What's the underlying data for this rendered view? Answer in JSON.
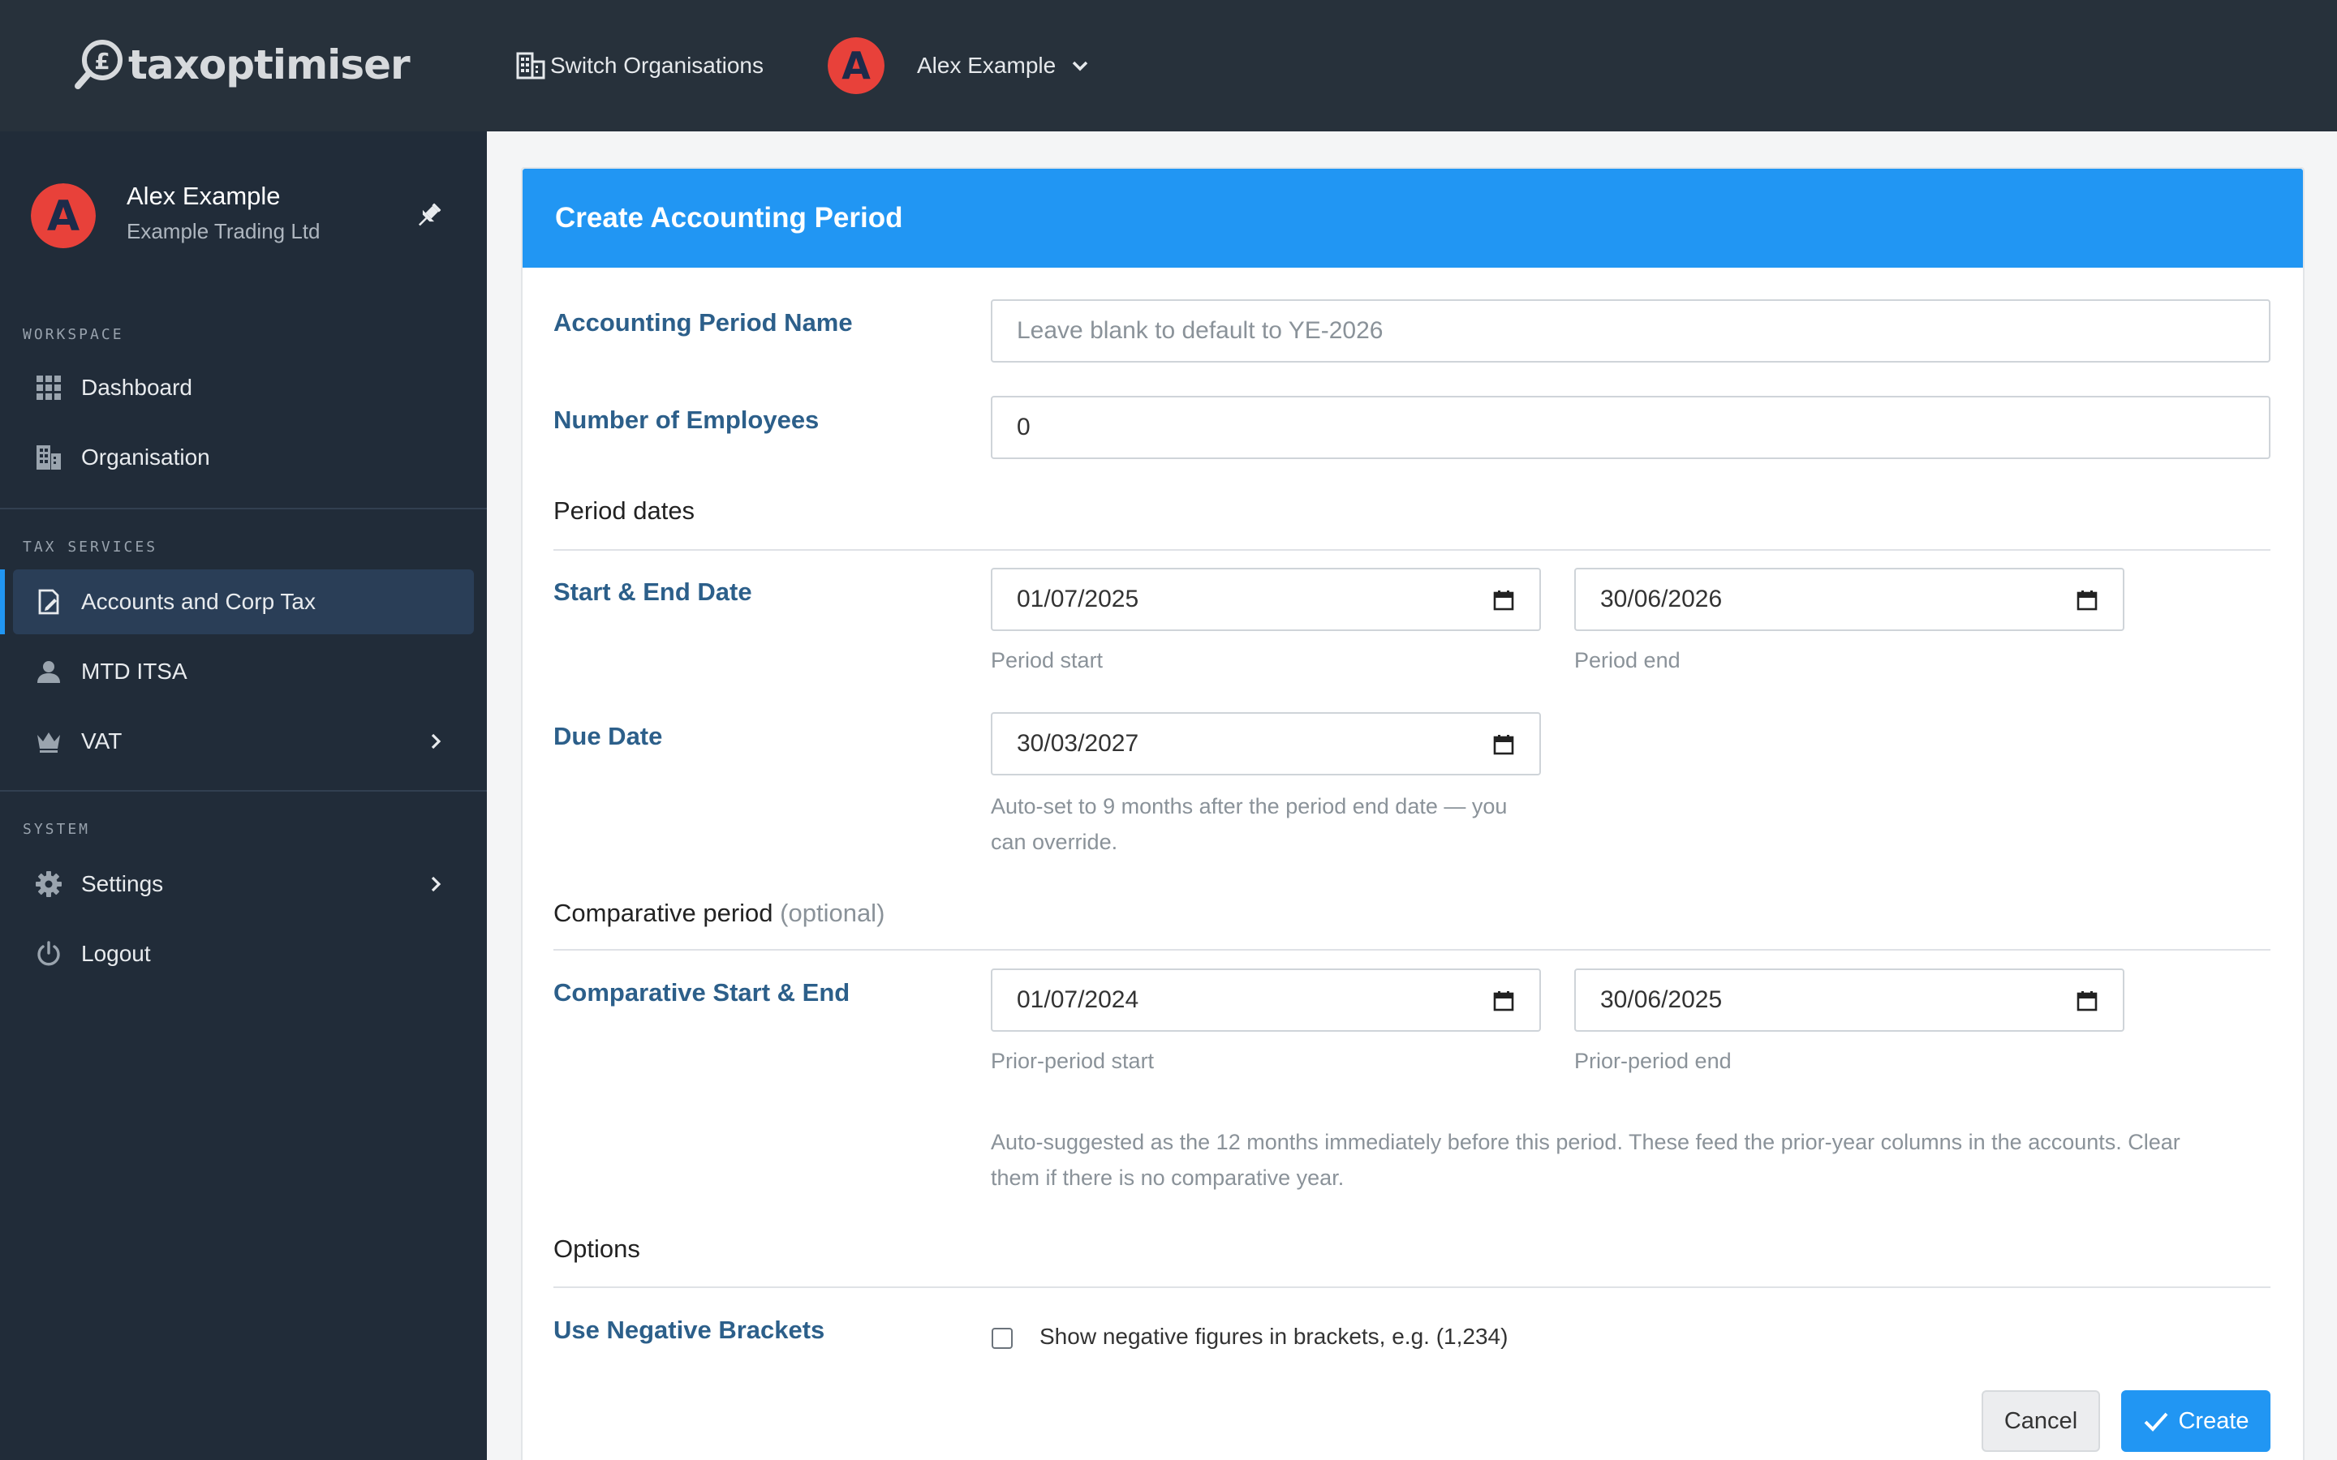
{
  "brand": {
    "name": "taxoptimiser"
  },
  "topbar": {
    "switch_org_label": "Switch Organisations",
    "user_name": "Alex Example",
    "avatar_letter": "A"
  },
  "sidebar": {
    "profile": {
      "name": "Alex Example",
      "org": "Example Trading Ltd",
      "avatar_letter": "A"
    },
    "sections": [
      {
        "label": "WORKSPACE",
        "items": [
          {
            "label": "Dashboard",
            "icon": "grid-icon"
          },
          {
            "label": "Organisation",
            "icon": "building-icon"
          }
        ]
      },
      {
        "label": "TAX SERVICES",
        "items": [
          {
            "label": "Accounts and Corp Tax",
            "icon": "document-edit-icon",
            "active": true
          },
          {
            "label": "MTD ITSA",
            "icon": "person-icon"
          },
          {
            "label": "VAT",
            "icon": "crown-icon",
            "has_submenu": true
          }
        ]
      },
      {
        "label": "SYSTEM",
        "items": [
          {
            "label": "Settings",
            "icon": "gear-icon",
            "has_submenu": true
          },
          {
            "label": "Logout",
            "icon": "power-icon"
          }
        ]
      }
    ]
  },
  "form": {
    "title": "Create Accounting Period",
    "name_label": "Accounting Period Name",
    "name_placeholder": "Leave blank to default to YE-2026",
    "employees_label": "Number of Employees",
    "employees_value": "0",
    "period_dates_title": "Period dates",
    "start_end_label": "Start & End Date",
    "start_date": "01/07/2025",
    "end_date": "30/06/2026",
    "start_hint": "Period start",
    "end_hint": "Period end",
    "due_label": "Due Date",
    "due_date": "30/03/2027",
    "due_hint_line1": "Auto-set to 9 months after the period end date — you",
    "due_hint_line2": "can override.",
    "comparative_title": "Comparative period",
    "comparative_optional": "(optional)",
    "comp_label": "Comparative Start & End",
    "comp_start": "01/07/2024",
    "comp_end": "30/06/2025",
    "comp_start_hint": "Prior-period start",
    "comp_end_hint": "Prior-period end",
    "comp_note_line1": "Auto-suggested as the 12 months immediately before this period. These feed the prior-year columns in the accounts. Clear",
    "comp_note_line2": "them if there is no comparative year.",
    "options_title": "Options",
    "neg_label": "Use Negative Brackets",
    "neg_checkbox_label": "Show negative figures in brackets, e.g. (1,234)",
    "neg_checked": false,
    "cancel_label": "Cancel",
    "create_label": "Create"
  },
  "colors": {
    "accent": "#2196f3",
    "topbar": "#27313b",
    "sidebar": "#212c39",
    "label": "#2c5f8a",
    "avatar": "#e8413a"
  }
}
